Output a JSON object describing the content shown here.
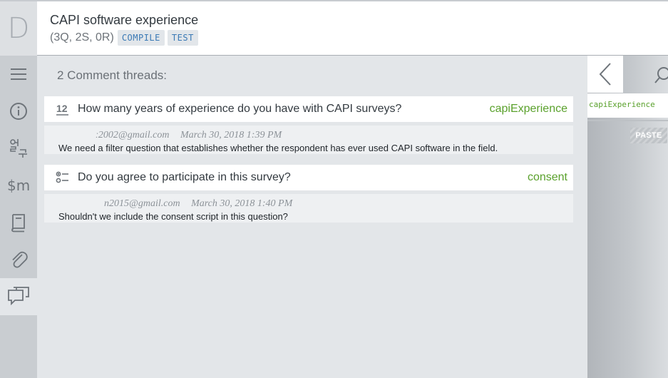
{
  "header": {
    "logo_letter": "D",
    "title": "CAPI software experience",
    "counts": "(3Q, 2S, 0R)",
    "tags": [
      "COMPILE",
      "TEST"
    ]
  },
  "sidebar": {
    "items": [
      {
        "icon": "hamburger-menu-icon"
      },
      {
        "icon": "info-icon"
      },
      {
        "icon": "translation-icon"
      },
      {
        "icon": "macro-dollar-icon"
      },
      {
        "icon": "book-icon"
      },
      {
        "icon": "paperclip-icon"
      },
      {
        "icon": "comments-icon",
        "active": true
      }
    ]
  },
  "main": {
    "heading": "2 Comment threads:",
    "threads": [
      {
        "question_icon": "numeric-question-icon",
        "question_icon_text": "12",
        "question": "How many years of experience do you have with CAPI surveys?",
        "variable": "capiExperience",
        "comment": {
          "author": "ː2002@gmail.com",
          "date": "March 30, 2018 1:39 PM",
          "text": "We need a filter question that establishes whether the respondent has ever used CAPI software in the field."
        }
      },
      {
        "question_icon": "single-select-question-icon",
        "question": "Do you agree to participate in this survey?",
        "variable": "consent",
        "comment": {
          "author": "n2015@gmail.com",
          "date": "March 30, 2018 1:40 PM",
          "text": "Shouldn't we include the consent script in this question?"
        }
      }
    ]
  },
  "right_panel": {
    "variable": "capiExperience",
    "paste_label": "PASTE"
  },
  "colors": {
    "accent_green": "#5aa12c",
    "tag_blue": "#3a79b5",
    "main_bg": "#e3e6e9",
    "sidebar_bg": "#c9cdd1"
  }
}
